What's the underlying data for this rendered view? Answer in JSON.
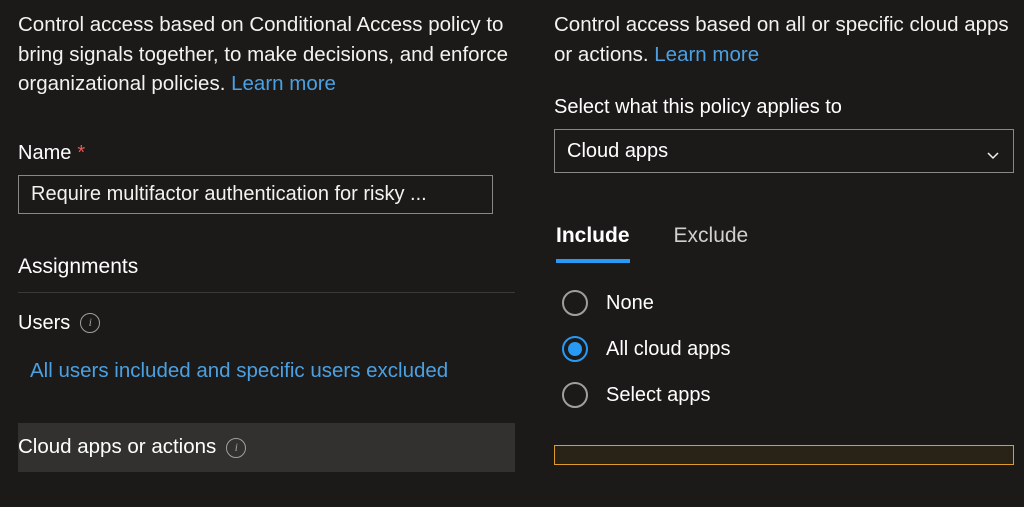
{
  "left": {
    "description": "Control access based on Conditional Access policy to bring signals together, to make decisions, and enforce organizational policies.",
    "learn_more": "Learn more",
    "name_label": "Name",
    "name_value": "Require multifactor authentication for risky ...",
    "assignments_heading": "Assignments",
    "users_label": "Users",
    "users_value": "All users included and specific users excluded",
    "cloud_apps_label": "Cloud apps or actions"
  },
  "right": {
    "description": "Control access based on all or specific cloud apps or actions.",
    "learn_more": "Learn more",
    "applies_label": "Select what this policy applies to",
    "dropdown_value": "Cloud apps",
    "tabs": {
      "include": "Include",
      "exclude": "Exclude"
    },
    "options": {
      "none": "None",
      "all": "All cloud apps",
      "select": "Select apps"
    }
  }
}
